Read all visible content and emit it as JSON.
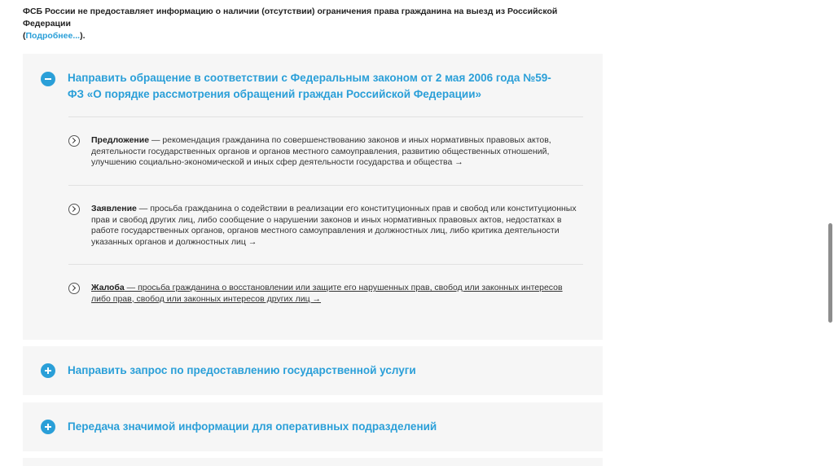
{
  "notice": {
    "text": "ФСБ России не предоставляет информацию о наличии (отсутствии) ограничения права гражданина на выезд из Российской Федерации",
    "open_paren": "(",
    "link": "Подробнее...",
    "close": ")."
  },
  "sections": [
    {
      "title": "Направить обращение в соответствии с Федеральным законом от 2 мая 2006 года №59-ФЗ «О порядке рассмотрения обращений граждан Российской Федерации»",
      "expanded": true,
      "items": [
        {
          "term": "Предложение",
          "text": " — рекомендация гражданина по совершенствованию законов и иных нормативных правовых актов, деятельности государственных органов и органов местного самоуправления, развитию общественных отношений, улучшению социально-экономической и иных сфер деятельности государства и общества →"
        },
        {
          "term": "Заявление",
          "text": " — просьба гражданина о содействии в реализации его конституционных прав и свобод или конституционных прав и свобод других лиц, либо сообщение о нарушении законов и иных нормативных правовых актов, недостатках в работе государственных органов, органов местного самоуправления и должностных лиц, либо критика деятельности указанных органов и должностных лиц →"
        },
        {
          "term": "Жалоба",
          "text": " — просьба гражданина о восстановлении или защите его нарушенных прав, свобод или законных интересов либо прав, свобод или законных интересов других лиц →"
        }
      ]
    },
    {
      "title": "Направить запрос по предоставлению государственной услуги",
      "expanded": false
    },
    {
      "title": "Передача значимой информации для оперативных подразделений",
      "expanded": false
    }
  ],
  "colors": {
    "accent": "#2a9fd8",
    "panel_bg": "#f6f6f6",
    "divider": "#e1e1e1"
  }
}
